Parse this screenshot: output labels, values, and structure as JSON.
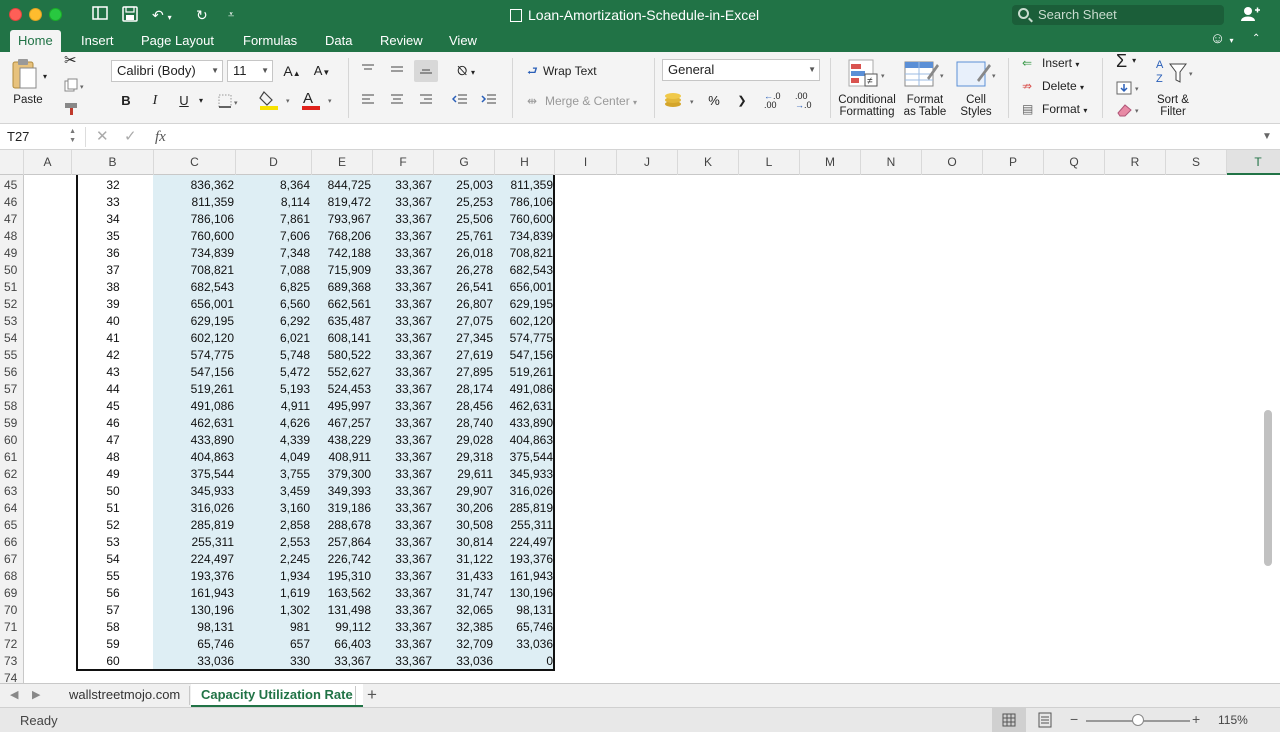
{
  "window": {
    "title": "Loan-Amortization-Schedule-in-Excel"
  },
  "search": {
    "placeholder": "Search Sheet"
  },
  "ribbon_tabs": [
    "Home",
    "Insert",
    "Page Layout",
    "Formulas",
    "Data",
    "Review",
    "View"
  ],
  "ribbon": {
    "paste_label": "Paste",
    "font_name": "Calibri (Body)",
    "font_size": "11",
    "bold": "B",
    "italic": "I",
    "underline": "U",
    "wrap_text": "Wrap Text",
    "merge_center": "Merge & Center",
    "number_format": "General",
    "percent": "%",
    "comma": "❯",
    "inc_decimal": "←.0\n.00",
    "conditional_formatting": [
      "Conditional",
      "Formatting"
    ],
    "format_as_table": [
      "Format",
      "as Table"
    ],
    "cell_styles": [
      "Cell",
      "Styles"
    ],
    "insert": "Insert",
    "delete": "Delete",
    "format": "Format",
    "sort_filter": [
      "Sort &",
      "Filter"
    ]
  },
  "formula_bar": {
    "cell_ref": "T27",
    "formula": ""
  },
  "columns": [
    "A",
    "B",
    "C",
    "D",
    "E",
    "F",
    "G",
    "H",
    "I",
    "J",
    "K",
    "L",
    "M",
    "N",
    "O",
    "P",
    "Q",
    "R",
    "S",
    "T"
  ],
  "selected_column": "T",
  "rows": [
    {
      "row": "45",
      "cells": [
        "32",
        "836,362",
        "8,364",
        "844,725",
        "33,367",
        "25,003",
        "811,359"
      ]
    },
    {
      "row": "46",
      "cells": [
        "33",
        "811,359",
        "8,114",
        "819,472",
        "33,367",
        "25,253",
        "786,106"
      ]
    },
    {
      "row": "47",
      "cells": [
        "34",
        "786,106",
        "7,861",
        "793,967",
        "33,367",
        "25,506",
        "760,600"
      ]
    },
    {
      "row": "48",
      "cells": [
        "35",
        "760,600",
        "7,606",
        "768,206",
        "33,367",
        "25,761",
        "734,839"
      ]
    },
    {
      "row": "49",
      "cells": [
        "36",
        "734,839",
        "7,348",
        "742,188",
        "33,367",
        "26,018",
        "708,821"
      ]
    },
    {
      "row": "50",
      "cells": [
        "37",
        "708,821",
        "7,088",
        "715,909",
        "33,367",
        "26,278",
        "682,543"
      ]
    },
    {
      "row": "51",
      "cells": [
        "38",
        "682,543",
        "6,825",
        "689,368",
        "33,367",
        "26,541",
        "656,001"
      ]
    },
    {
      "row": "52",
      "cells": [
        "39",
        "656,001",
        "6,560",
        "662,561",
        "33,367",
        "26,807",
        "629,195"
      ]
    },
    {
      "row": "53",
      "cells": [
        "40",
        "629,195",
        "6,292",
        "635,487",
        "33,367",
        "27,075",
        "602,120"
      ]
    },
    {
      "row": "54",
      "cells": [
        "41",
        "602,120",
        "6,021",
        "608,141",
        "33,367",
        "27,345",
        "574,775"
      ]
    },
    {
      "row": "55",
      "cells": [
        "42",
        "574,775",
        "5,748",
        "580,522",
        "33,367",
        "27,619",
        "547,156"
      ]
    },
    {
      "row": "56",
      "cells": [
        "43",
        "547,156",
        "5,472",
        "552,627",
        "33,367",
        "27,895",
        "519,261"
      ]
    },
    {
      "row": "57",
      "cells": [
        "44",
        "519,261",
        "5,193",
        "524,453",
        "33,367",
        "28,174",
        "491,086"
      ]
    },
    {
      "row": "58",
      "cells": [
        "45",
        "491,086",
        "4,911",
        "495,997",
        "33,367",
        "28,456",
        "462,631"
      ]
    },
    {
      "row": "59",
      "cells": [
        "46",
        "462,631",
        "4,626",
        "467,257",
        "33,367",
        "28,740",
        "433,890"
      ]
    },
    {
      "row": "60",
      "cells": [
        "47",
        "433,890",
        "4,339",
        "438,229",
        "33,367",
        "29,028",
        "404,863"
      ]
    },
    {
      "row": "61",
      "cells": [
        "48",
        "404,863",
        "4,049",
        "408,911",
        "33,367",
        "29,318",
        "375,544"
      ]
    },
    {
      "row": "62",
      "cells": [
        "49",
        "375,544",
        "3,755",
        "379,300",
        "33,367",
        "29,611",
        "345,933"
      ]
    },
    {
      "row": "63",
      "cells": [
        "50",
        "345,933",
        "3,459",
        "349,393",
        "33,367",
        "29,907",
        "316,026"
      ]
    },
    {
      "row": "64",
      "cells": [
        "51",
        "316,026",
        "3,160",
        "319,186",
        "33,367",
        "30,206",
        "285,819"
      ]
    },
    {
      "row": "65",
      "cells": [
        "52",
        "285,819",
        "2,858",
        "288,678",
        "33,367",
        "30,508",
        "255,311"
      ]
    },
    {
      "row": "66",
      "cells": [
        "53",
        "255,311",
        "2,553",
        "257,864",
        "33,367",
        "30,814",
        "224,497"
      ]
    },
    {
      "row": "67",
      "cells": [
        "54",
        "224,497",
        "2,245",
        "226,742",
        "33,367",
        "31,122",
        "193,376"
      ]
    },
    {
      "row": "68",
      "cells": [
        "55",
        "193,376",
        "1,934",
        "195,310",
        "33,367",
        "31,433",
        "161,943"
      ]
    },
    {
      "row": "69",
      "cells": [
        "56",
        "161,943",
        "1,619",
        "163,562",
        "33,367",
        "31,747",
        "130,196"
      ]
    },
    {
      "row": "70",
      "cells": [
        "57",
        "130,196",
        "1,302",
        "131,498",
        "33,367",
        "32,065",
        "98,131"
      ]
    },
    {
      "row": "71",
      "cells": [
        "58",
        "98,131",
        "981",
        "99,112",
        "33,367",
        "32,385",
        "65,746"
      ]
    },
    {
      "row": "72",
      "cells": [
        "59",
        "65,746",
        "657",
        "66,403",
        "33,367",
        "32,709",
        "33,036"
      ]
    },
    {
      "row": "73",
      "cells": [
        "60",
        "33,036",
        "330",
        "33,367",
        "33,367",
        "33,036",
        "0"
      ]
    },
    {
      "row": "74",
      "cells": [
        "",
        "",
        "",
        "",
        "",
        "",
        ""
      ]
    }
  ],
  "sheet_tabs": [
    "wallstreetmojo.com",
    "Capacity Utilization Rate"
  ],
  "active_sheet": "Capacity Utilization Rate",
  "status": {
    "text": "Ready",
    "zoom": "115%"
  },
  "colors": {
    "accent": "#217346",
    "selection_fill": "#deeef4"
  }
}
